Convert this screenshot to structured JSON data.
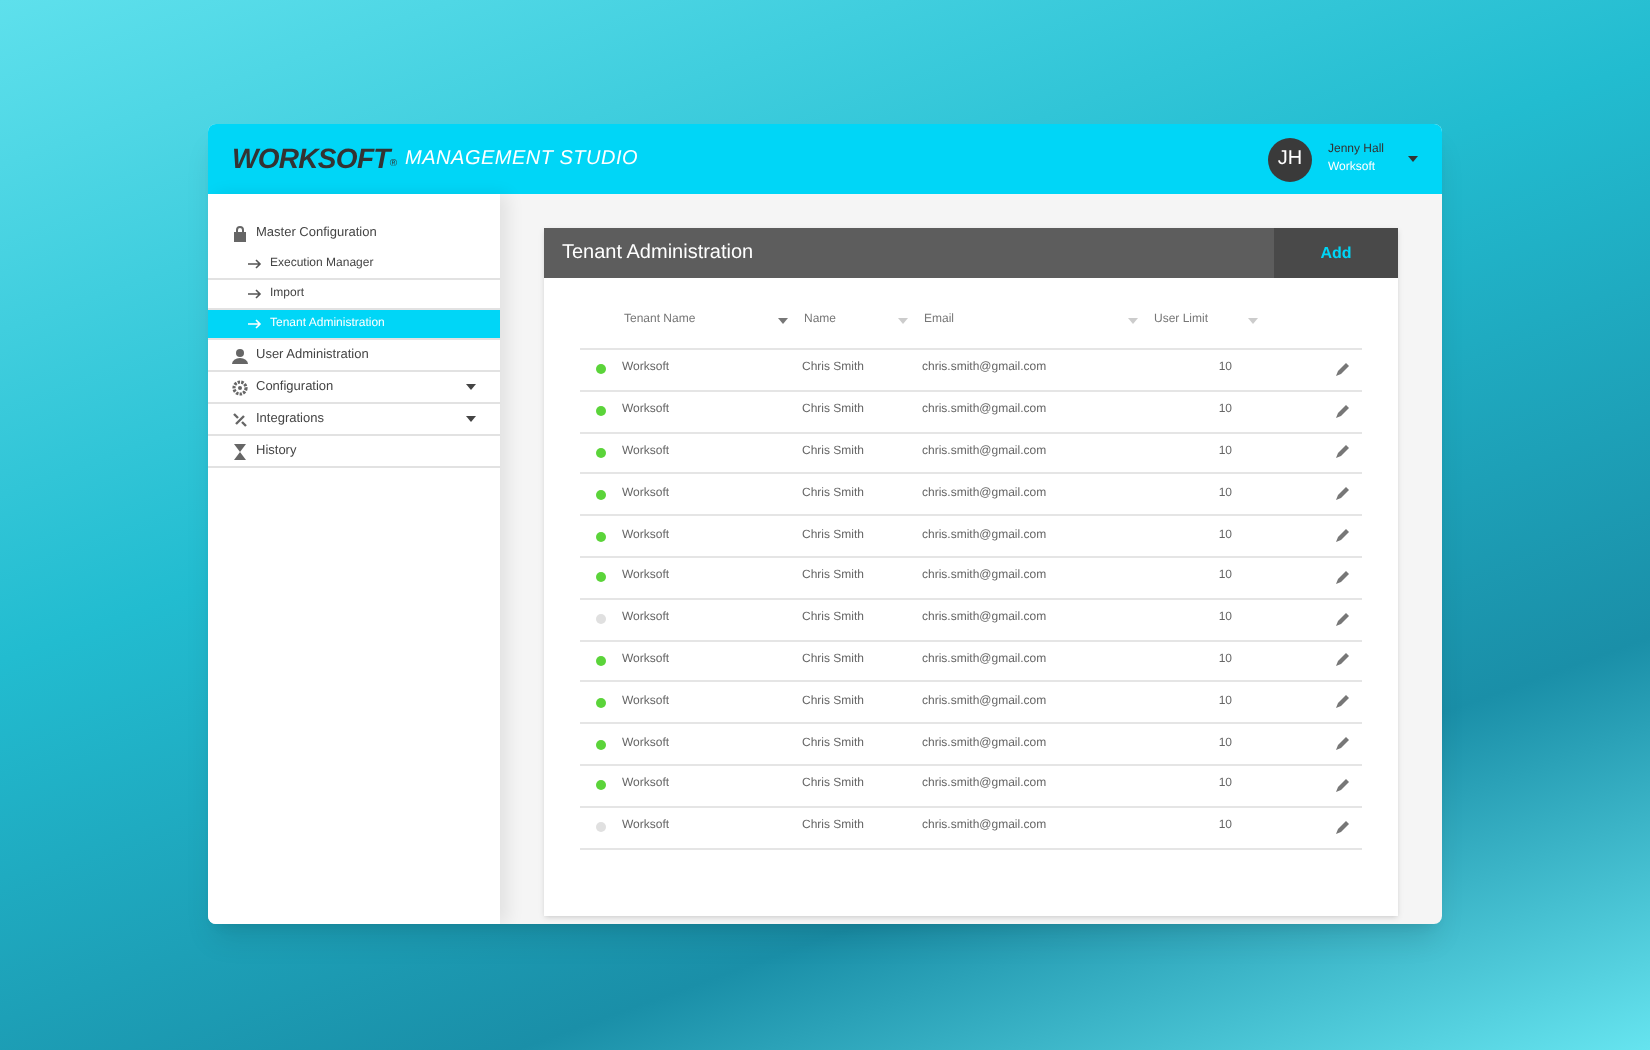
{
  "header": {
    "logo": "WORKSOFT",
    "logo_mark": "®",
    "product": "MANAGEMENT STUDIO",
    "user": {
      "initials": "JH",
      "name": "Jenny Hall",
      "org": "Worksoft"
    }
  },
  "sidebar": {
    "items": [
      {
        "label": "Master Configuration",
        "kind": "lock",
        "expandable": false,
        "children": [
          {
            "label": "Execution Manager",
            "selected": false
          },
          {
            "label": "Import",
            "selected": false
          },
          {
            "label": "Tenant Administration",
            "selected": true
          }
        ]
      },
      {
        "label": "User Administration",
        "kind": "user",
        "expandable": false
      },
      {
        "label": "Configuration",
        "kind": "gear",
        "expandable": true
      },
      {
        "label": "Integrations",
        "kind": "plug",
        "expandable": true
      },
      {
        "label": "History",
        "kind": "hourglass",
        "expandable": false
      }
    ]
  },
  "panel": {
    "title": "Tenant Administration",
    "add_button": "Add",
    "table": {
      "columns": [
        "Tenant Name",
        "Name",
        "Email",
        "User Limit"
      ],
      "rows": [
        {
          "active": true,
          "tenant": "Worksoft",
          "name": "Chris Smith",
          "email": "chris.smith@gmail.com",
          "limit": "10"
        },
        {
          "active": true,
          "tenant": "Worksoft",
          "name": "Chris Smith",
          "email": "chris.smith@gmail.com",
          "limit": "10"
        },
        {
          "active": true,
          "tenant": "Worksoft",
          "name": "Chris Smith",
          "email": "chris.smith@gmail.com",
          "limit": "10"
        },
        {
          "active": true,
          "tenant": "Worksoft",
          "name": "Chris Smith",
          "email": "chris.smith@gmail.com",
          "limit": "10"
        },
        {
          "active": true,
          "tenant": "Worksoft",
          "name": "Chris Smith",
          "email": "chris.smith@gmail.com",
          "limit": "10"
        },
        {
          "active": true,
          "tenant": "Worksoft",
          "name": "Chris Smith",
          "email": "chris.smith@gmail.com",
          "limit": "10"
        },
        {
          "active": false,
          "tenant": "Worksoft",
          "name": "Chris Smith",
          "email": "chris.smith@gmail.com",
          "limit": "10"
        },
        {
          "active": true,
          "tenant": "Worksoft",
          "name": "Chris Smith",
          "email": "chris.smith@gmail.com",
          "limit": "10"
        },
        {
          "active": true,
          "tenant": "Worksoft",
          "name": "Chris Smith",
          "email": "chris.smith@gmail.com",
          "limit": "10"
        },
        {
          "active": true,
          "tenant": "Worksoft",
          "name": "Chris Smith",
          "email": "chris.smith@gmail.com",
          "limit": "10"
        },
        {
          "active": true,
          "tenant": "Worksoft",
          "name": "Chris Smith",
          "email": "chris.smith@gmail.com",
          "limit": "10"
        },
        {
          "active": false,
          "tenant": "Worksoft",
          "name": "Chris Smith",
          "email": "chris.smith@gmail.com",
          "limit": "10"
        }
      ]
    }
  }
}
